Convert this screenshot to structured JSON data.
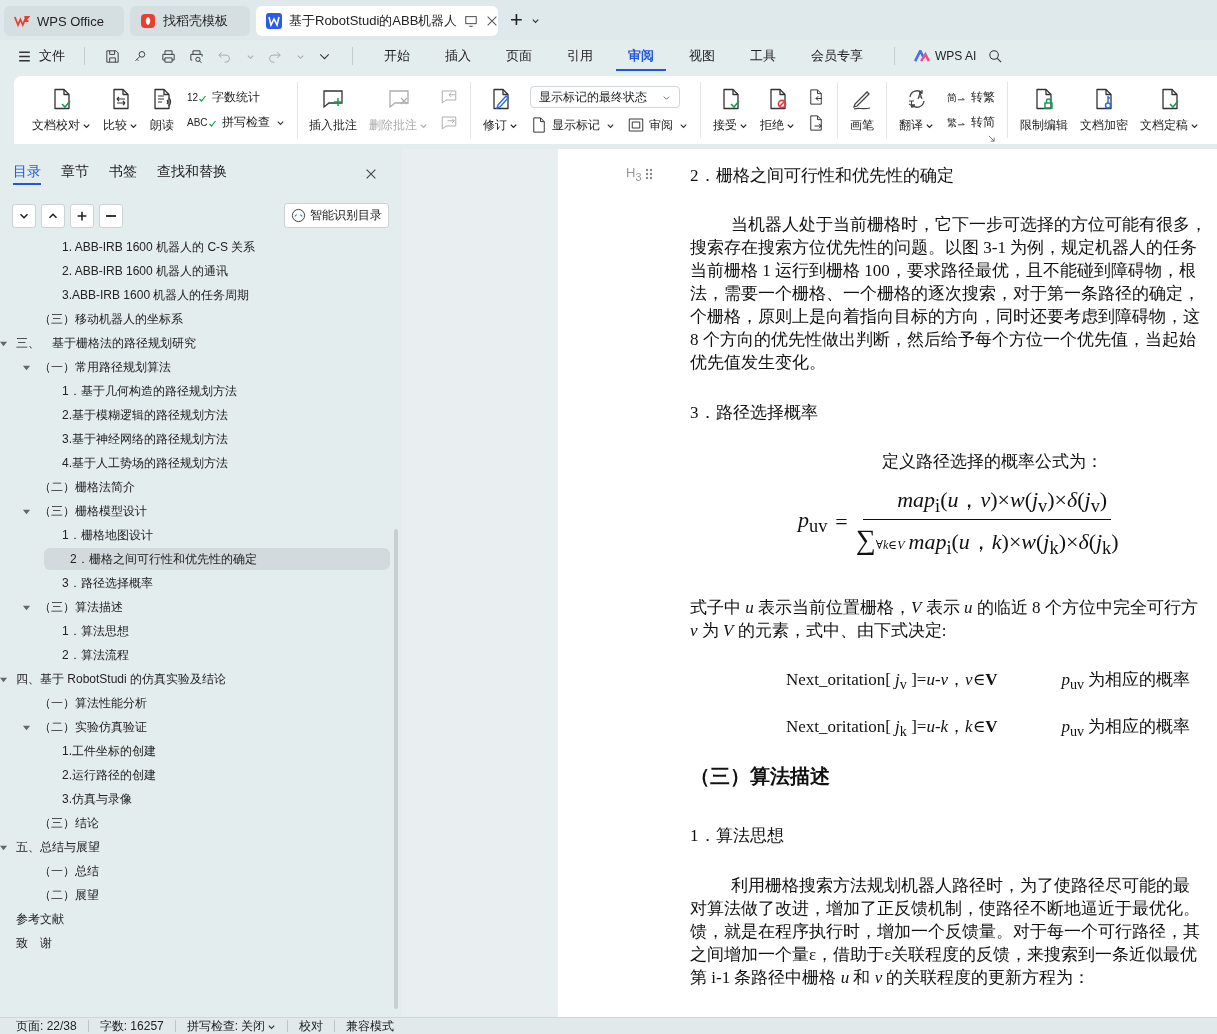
{
  "title_tabs": [
    {
      "label": "WPS Office",
      "kind": "home",
      "selected": false
    },
    {
      "label": "找稻壳模板",
      "kind": "template",
      "selected": false
    },
    {
      "label": "基于RobotStudi的ABB机器人",
      "kind": "document",
      "selected": true
    }
  ],
  "new_tab": "+",
  "menu": {
    "file": "文件",
    "tabs": [
      {
        "label": "开始",
        "selected": false
      },
      {
        "label": "插入",
        "selected": false
      },
      {
        "label": "页面",
        "selected": false
      },
      {
        "label": "引用",
        "selected": false
      },
      {
        "label": "审阅",
        "selected": true
      },
      {
        "label": "视图",
        "selected": false
      },
      {
        "label": "工具",
        "selected": false
      },
      {
        "label": "会员专享",
        "selected": false
      }
    ],
    "ai": "WPS AI"
  },
  "ribbon": [
    {
      "items": [
        {
          "kind": "large",
          "label": "文档校对",
          "caret": true,
          "disabled": false
        },
        {
          "kind": "large",
          "label": "比较",
          "caret": true,
          "disabled": false
        },
        {
          "kind": "large",
          "label": "朗读",
          "caret": false,
          "disabled": false
        },
        {
          "kind": "stack",
          "items": [
            {
              "kind": "small",
              "glyph": "12",
              "label": "字数统计",
              "caret": false
            },
            {
              "kind": "small",
              "glyph": "ABC",
              "label": "拼写检查",
              "caret": true
            }
          ]
        }
      ]
    },
    {
      "items": [
        {
          "kind": "large",
          "label": "插入批注",
          "caret": false,
          "disabled": false
        },
        {
          "kind": "large",
          "label": "删除批注",
          "caret": true,
          "disabled": true
        },
        {
          "kind": "stack",
          "items": [
            {
              "kind": "icon",
              "disabled": true
            },
            {
              "kind": "icon",
              "disabled": true
            }
          ]
        }
      ]
    },
    {
      "items": [
        {
          "kind": "large",
          "label": "修订",
          "caret": true,
          "disabled": false
        },
        {
          "kind": "stack",
          "items": [
            {
              "kind": "select",
              "value": "显示标记的最终状态"
            },
            {
              "kind": "row",
              "items": [
                {
                  "kind": "small",
                  "label": "显示标记",
                  "caret": true
                },
                {
                  "kind": "small",
                  "label": "审阅",
                  "caret": true
                }
              ]
            }
          ]
        }
      ]
    },
    {
      "items": [
        {
          "kind": "large",
          "label": "接受",
          "caret": true,
          "disabled": false
        },
        {
          "kind": "large",
          "label": "拒绝",
          "caret": true,
          "disabled": false
        },
        {
          "kind": "stack",
          "items": [
            {
              "kind": "icon",
              "disabled": false
            },
            {
              "kind": "icon",
              "disabled": false
            }
          ]
        }
      ]
    },
    {
      "items": [
        {
          "kind": "large",
          "label": "画笔",
          "caret": false,
          "disabled": false
        }
      ]
    },
    {
      "items": [
        {
          "kind": "large",
          "label": "翻译",
          "caret": true,
          "disabled": false
        },
        {
          "kind": "stack",
          "items": [
            {
              "kind": "small",
              "glyph": "简",
              "label": "转繁",
              "caret": false
            },
            {
              "kind": "small",
              "glyph": "繁",
              "label": "转简",
              "caret": false
            }
          ]
        }
      ]
    },
    {
      "items": [
        {
          "kind": "large",
          "label": "限制编辑",
          "caret": false,
          "disabled": false
        },
        {
          "kind": "large",
          "label": "文档加密",
          "caret": false,
          "disabled": false
        },
        {
          "kind": "large",
          "label": "文档定稿",
          "caret": true,
          "disabled": false
        }
      ]
    }
  ],
  "sidebar": {
    "tabs": [
      {
        "label": "目录",
        "selected": true
      },
      {
        "label": "章节",
        "selected": false
      },
      {
        "label": "书签",
        "selected": false
      },
      {
        "label": "查找和替换",
        "selected": false
      }
    ],
    "smart_button": "智能识别目录",
    "toc": [
      {
        "children": [
          {
            "children": [
              {
                "label": "1. ABB-IRB 1600 机器人的 C-S 关系",
                "selected": false
              },
              {
                "label": "2. ABB-IRB 1600 机器人的通讯",
                "selected": false
              },
              {
                "label": "3.ABB-IRB 1600 机器人的任务周期",
                "selected": false
              }
            ]
          },
          {
            "label": "（三）移动机器人的坐标系",
            "selected": false
          }
        ]
      },
      {
        "label": "三、　基于栅格法的路径规划研究",
        "selected": false,
        "expanded": true,
        "children": [
          {
            "label": "（一）常用路径规划算法",
            "selected": false,
            "expanded": true,
            "children": [
              {
                "label": "1．基于几何构造的路径规划方法",
                "selected": false
              },
              {
                "label": "2.基于模糊逻辑的路径规划方法",
                "selected": false
              },
              {
                "label": "3.基于神经网络的路径规划方法",
                "selected": false
              },
              {
                "label": "4.基于人工势场的路径规划方法",
                "selected": false
              }
            ]
          },
          {
            "label": "（二）栅格法简介",
            "selected": false
          },
          {
            "label": "（三）栅格模型设计",
            "selected": false,
            "expanded": true,
            "children": [
              {
                "label": "1．栅格地图设计",
                "selected": false
              },
              {
                "label": "2．栅格之间可行性和优先性的确定",
                "selected": true
              },
              {
                "label": "3．路径选择概率",
                "selected": false
              }
            ]
          },
          {
            "label": "（三）算法描述",
            "selected": false,
            "expanded": true,
            "children": [
              {
                "label": "1．算法思想",
                "selected": false
              },
              {
                "label": "2．算法流程",
                "selected": false
              }
            ]
          }
        ]
      },
      {
        "label": "四、基于 RobotStudi 的仿真实验及结论",
        "selected": false,
        "expanded": true,
        "children": [
          {
            "label": "（一）算法性能分析",
            "selected": false
          },
          {
            "label": "（二）实验仿真验证",
            "selected": false,
            "expanded": true,
            "children": [
              {
                "label": "1.工件坐标的创建",
                "selected": false
              },
              {
                "label": "2.运行路径的创建",
                "selected": false
              },
              {
                "label": "3.仿真与录像",
                "selected": false
              }
            ]
          },
          {
            "label": "（三）结论",
            "selected": false
          }
        ]
      },
      {
        "label": "五、总结与展望",
        "selected": false,
        "expanded": true,
        "children": [
          {
            "label": "（一）总结",
            "selected": false
          },
          {
            "label": "（二）展望",
            "selected": false
          }
        ]
      },
      {
        "label": "参考文献",
        "selected": false
      },
      {
        "label": "致　谢",
        "selected": false
      }
    ]
  },
  "document": [
    {
      "kind": "heading",
      "marker": "H$_{3}$",
      "text": "2．栅格之间可行性和优先性的确定"
    },
    {
      "kind": "paragraph",
      "noindent": false,
      "lines": [
        "当机器人处于当前栅格时，它下一步可选择的方位可能有很多，",
        "搜索存在搜索方位优先性的问题。以图 3-1 为例，规定机器人的任务",
        "当前栅格 1 运行到栅格 100，要求路径最优，且不能碰到障碍物，根",
        "法，需要一个栅格、一个栅格的逐次搜索，对于第一条路径的确定，",
        "个栅格，原则上是向着指向目标的方向，同时还要考虑到障碍物，这",
        "8 个方向的优先性做出判断，然后给予每个方位一个优先值，当起始",
        "优先值发生变化。"
      ]
    },
    {
      "kind": "heading",
      "text": "3．路径选择概率"
    },
    {
      "kind": "caption",
      "text": "定义路径选择的概率公式为："
    },
    {
      "kind": "formula",
      "lhs": "*p*$_{uv}$",
      "equals": "=",
      "numerator": "*map*$_{i}$(*u*，*v*)×*w*(*j*$_{v}$)×*δ*(*j*$_{v}$)",
      "sum": "∑",
      "sum_range": "∀*k*∈*V*",
      "denominator": "*map*$_{i}$(*u*，*k*)×*w*(*j*$_{k}$)×*δ*(*j*$_{k}$)"
    },
    {
      "kind": "paragraph",
      "noindent": true,
      "lines": [
        "式子中 *u* 表示当前位置栅格，*V* 表示 *u* 的临近 8 个方位中完全可行方",
        "*v* 为 *V* 的元素，式中、由下式决定:"
      ]
    },
    {
      "kind": "equation",
      "expr": "Next_oritation[ *j*$_{v}$ ]=*u*-*v*，*v*∈**V**",
      "note": "*p*$_{uv}$ 为相应的概率"
    },
    {
      "kind": "equation",
      "expr": "Next_oritation[ *j*$_{k}$ ]=*u*-*k*，*k*∈**V**",
      "note": "*p*$_{uv}$ 为相应的概率"
    },
    {
      "kind": "section",
      "text": "（三）算法描述"
    },
    {
      "kind": "heading",
      "text": "1．算法思想"
    },
    {
      "kind": "paragraph",
      "noindent": false,
      "lines": [
        "利用栅格搜索方法规划机器人路径时，为了使路径尽可能的最",
        "对算法做了改进，增加了正反馈机制，使路径不断地逼近于最优化。",
        "馈，就是在程序执行时，增加一个反馈量。对于每一个可行路径，其",
        "之间增加一个量ε，借助于ε关联程度的反馈，来搜索到一条近似最优",
        "第 i-1 条路径中栅格 *u* 和 *v* 的关联程度的更新方程为："
      ]
    }
  ],
  "status_bar": [
    {
      "label": "页面: 22/38",
      "caret": false
    },
    {
      "label": "字数: 16257",
      "caret": false
    },
    {
      "label": "拼写检查: 关闭",
      "caret": true
    },
    {
      "label": "校对",
      "caret": false
    },
    {
      "label": "兼容模式",
      "caret": false
    }
  ]
}
